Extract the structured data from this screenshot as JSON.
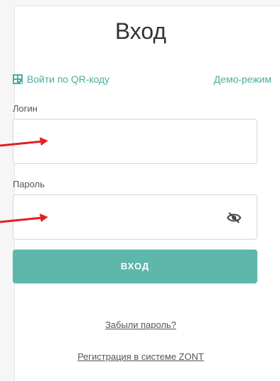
{
  "page": {
    "title": "Вход",
    "qr_link": "Войти по QR-коду",
    "demo_link": "Демо-режим",
    "login_label": "Логин",
    "login_value": "",
    "password_label": "Пароль",
    "password_value": "",
    "submit_label": "ВХОД",
    "forgot_link": "Забыли пароль?",
    "register_link": "Регистрация в системе ZONT"
  },
  "colors": {
    "accent": "#4cab9d",
    "button": "#5db7ab",
    "arrow": "#e02020"
  },
  "icons": {
    "qr": "qr-code-icon",
    "eye": "eye-off-icon",
    "arrow": "red-arrow-icon"
  }
}
